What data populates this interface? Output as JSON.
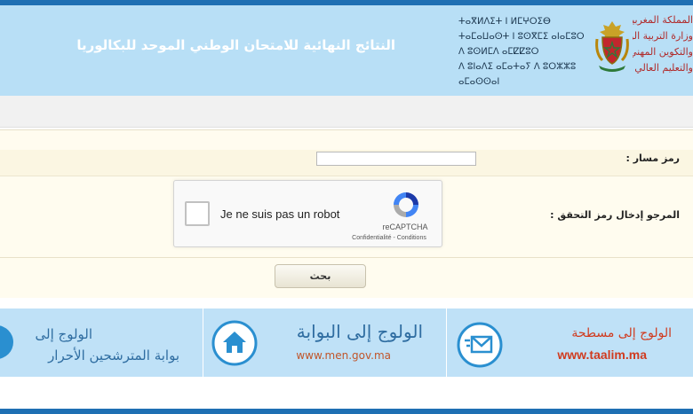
{
  "header": {
    "title": "النتائج النهائية للامتحان الوطني الموحد للبكالوريا",
    "tifinagh_lines": [
      "ⵜⴰⴳⵍⴷⵉⵜ ⵏ ⵍⵎⵖⵔⵉⴱ",
      "ⵜⴰⵎⴰⵡⴰⵙⵜ ⵏ ⵓⵙⴳⵎⵉ ⴰⵏⴰⵎⵓⵔ",
      "ⴷ ⵓⵙⵍⵎⴷ ⴰⵎⵇⵇⵓⵔ",
      "ⴷ ⵓⵏⴰⴷⵉ ⴰⵎⴰⵜⴰⵢ ⴷ ⵓⵔⵣⵣⵓ ⴰⵎⴰⵙⵙⴰⵏ"
    ],
    "ministry_lines": [
      "المملكة المغربية",
      "وزارة التربية الوطنية",
      "والتكوين المهني",
      "والتعليم العالي والبحث العلمي"
    ]
  },
  "form": {
    "massar_label": "رمز مسار :",
    "massar_value": "",
    "captcha_label": "المرجو إدخال رمز التحقق :",
    "search_label": "بحث"
  },
  "recaptcha": {
    "checkbox_text": "Je ne suis pas un robot",
    "brand": "reCAPTCHA",
    "privacy": "Confidentialité",
    "separator": " - ",
    "terms": "Conditions"
  },
  "banners": [
    {
      "line1": "الولوج إلى",
      "line2": "بوابة المترشحين الأحرار",
      "icon": "arrow-circle-icon"
    },
    {
      "line1": "الولوج إلى البوابة",
      "line2": "www.men.gov.ma",
      "icon": "home-icon"
    },
    {
      "line1": "الولوج إلى مسطحة",
      "line2": "www.taalim.ma",
      "icon": "mail-icon"
    }
  ],
  "colors": {
    "header_bg": "#b8dff6",
    "top_bar": "#1e6fb3",
    "banner_bg": "#bfe1f7",
    "banner_text": "#2f6da1",
    "taalim_url": "#d03b1f",
    "men_url": "#c0552a"
  }
}
